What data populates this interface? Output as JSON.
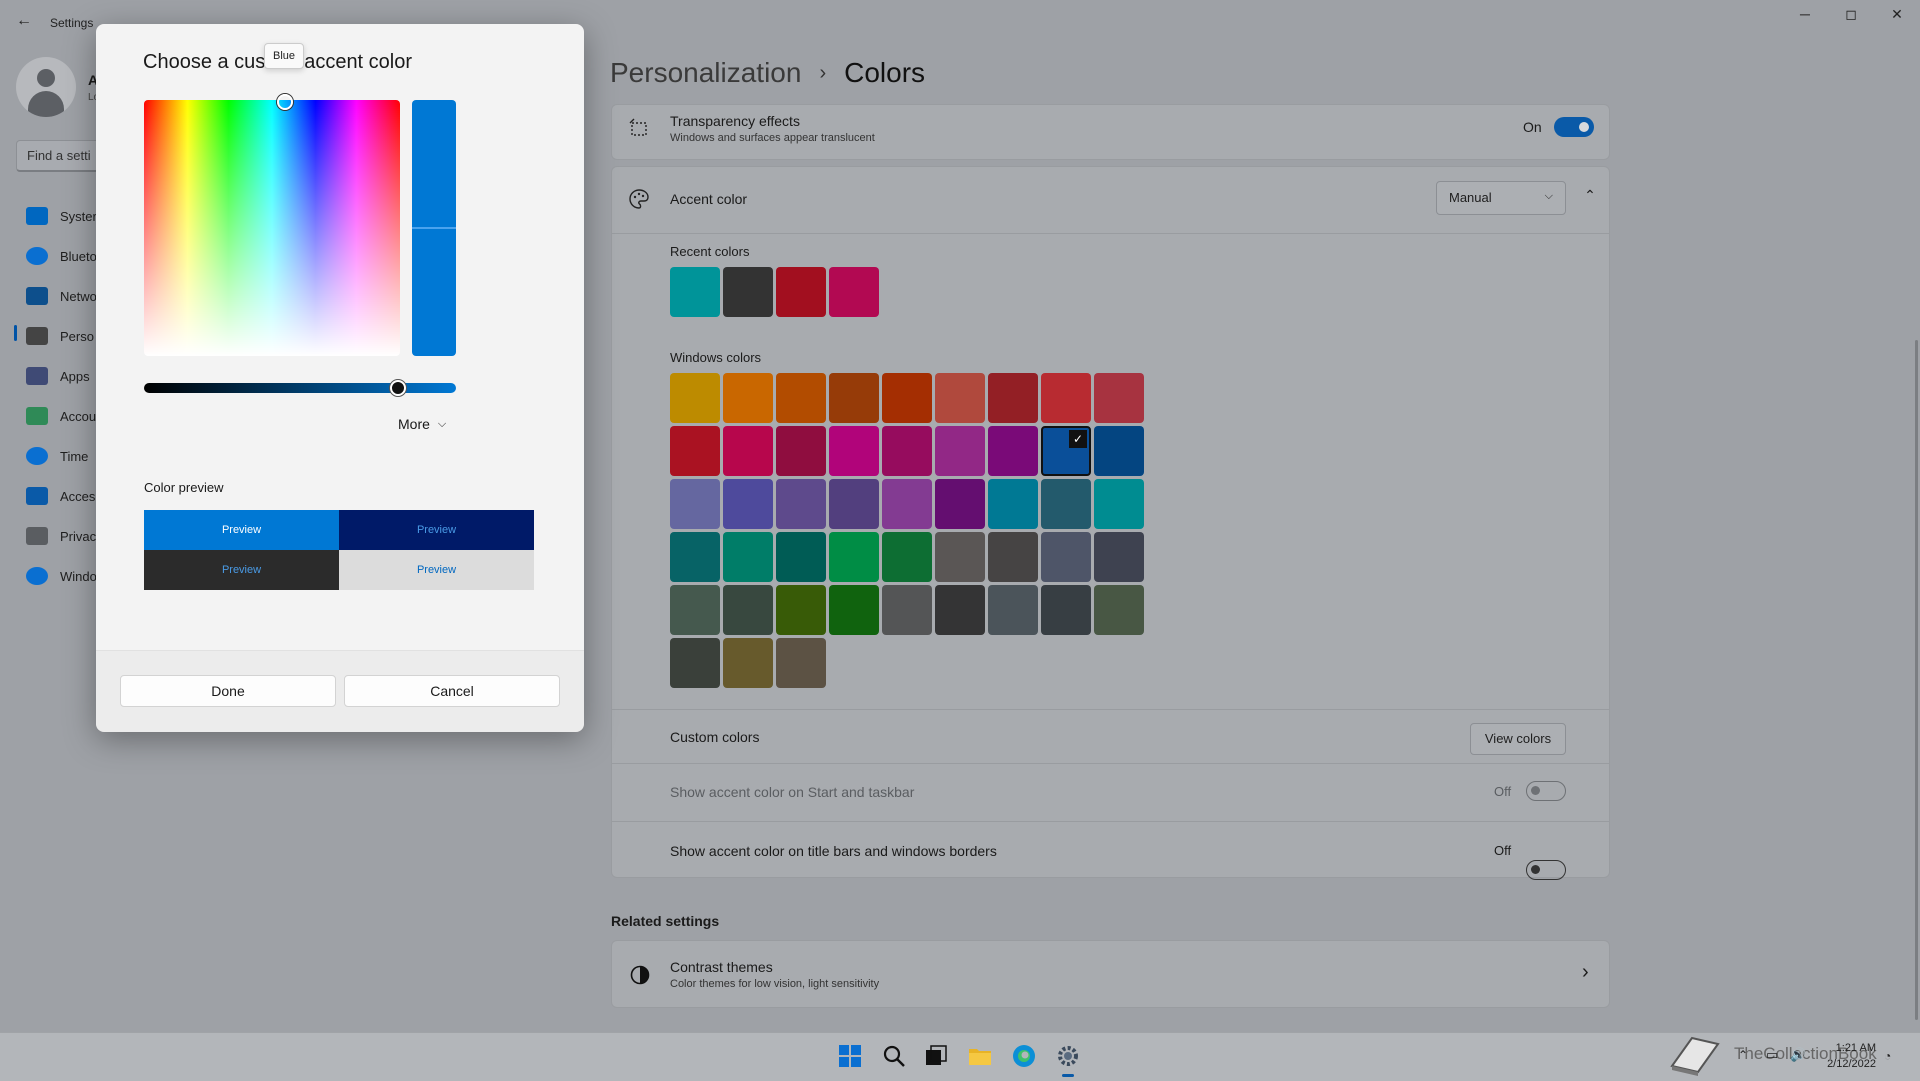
{
  "window": {
    "title": "Settings",
    "back": "←",
    "minimize": "─",
    "maximize": "◻",
    "close": "✕"
  },
  "account": {
    "name": "A",
    "sub": "Lo"
  },
  "search": {
    "placeholder": "Find a setti"
  },
  "nav": [
    {
      "label": "Syster",
      "icon": "system-icon"
    },
    {
      "label": "Blueto",
      "icon": "bluetooth-icon"
    },
    {
      "label": "Netwo",
      "icon": "network-icon"
    },
    {
      "label": "Perso",
      "icon": "personalization-icon"
    },
    {
      "label": "Apps",
      "icon": "apps-icon"
    },
    {
      "label": "Accou",
      "icon": "accounts-icon"
    },
    {
      "label": "Time",
      "icon": "time-icon"
    },
    {
      "label": "Acces",
      "icon": "accessibility-icon"
    },
    {
      "label": "Privac",
      "icon": "privacy-icon"
    },
    {
      "label": "Windo",
      "icon": "windows-update-icon"
    }
  ],
  "header": {
    "crumb": "Personalization",
    "sep": "›",
    "current": "Colors"
  },
  "transparency": {
    "title": "Transparency effects",
    "sub": "Windows and surfaces appear translucent",
    "state": "On"
  },
  "accent": {
    "title": "Accent color",
    "mode": "Manual"
  },
  "recent": {
    "label": "Recent colors",
    "colors": [
      "#009499",
      "#333333",
      "#a20f1f",
      "#b20952"
    ]
  },
  "windows_colors": {
    "label": "Windows colors",
    "rows": [
      [
        "#bd8b00",
        "#c96700",
        "#b24c00",
        "#963b08",
        "#a42e02",
        "#b0493d",
        "#931f25",
        "#b82b31",
        "#a73340"
      ],
      [
        "#aa1222",
        "#b7064c",
        "#8f0d3f",
        "#b1047a",
        "#960c5e",
        "#922886",
        "#7a0a78",
        "#0a4f99",
        "#044581"
      ],
      [
        "#6567a0",
        "#4e4a9c",
        "#5e4a8c",
        "#523f7e",
        "#833b92",
        "#640e70",
        "#007994",
        "#235a6c",
        "#008c91"
      ],
      [
        "#076366",
        "#007d68",
        "#005c55",
        "#008d45",
        "#0d6e33",
        "#5a5655",
        "#464444",
        "#4e5568",
        "#3e4250"
      ],
      [
        "#45594e",
        "#38483f",
        "#385b07",
        "#10630e",
        "#545556",
        "#343435",
        "#4b545a",
        "#373e43",
        "#485744"
      ],
      [
        "#3a403a",
        "#675a2c",
        "#5c5244"
      ]
    ],
    "selected": {
      "row": 1,
      "col": 7
    },
    "check": "✓"
  },
  "custom": {
    "title": "Custom colors",
    "button": "View colors"
  },
  "start_taskbar": {
    "title": "Show accent color on Start and taskbar",
    "state": "Off"
  },
  "title_bars": {
    "title": "Show accent color on title bars and windows borders",
    "state": "Off"
  },
  "related": {
    "label": "Related settings",
    "contrast_title": "Contrast themes",
    "contrast_sub": "Color themes for low vision, light sensitivity",
    "chevron": "›"
  },
  "dialog": {
    "title": "Choose a custom accent color",
    "tooltip": "Blue",
    "more": "More",
    "preview_label": "Color preview",
    "previews": [
      "Preview",
      "Preview",
      "Preview",
      "Preview"
    ],
    "done": "Done",
    "cancel": "Cancel",
    "color": "#0078d4"
  },
  "tray": {
    "time": "1:21 AM",
    "date": "2/12/2022",
    "watermark": "TheCollectionBook"
  }
}
